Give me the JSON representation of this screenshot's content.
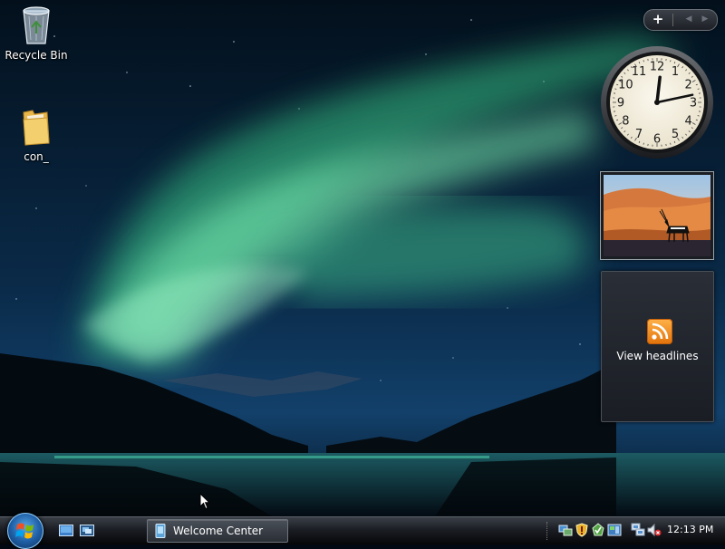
{
  "desktop": {
    "icons": [
      {
        "name": "recycle-bin",
        "label": "Recycle Bin"
      },
      {
        "name": "folder",
        "label": "con_"
      }
    ]
  },
  "sidebar": {
    "controls": {
      "add": "+"
    },
    "clock": {
      "numerals": [
        "12",
        "1",
        "2",
        "3",
        "4",
        "5",
        "6",
        "7",
        "8",
        "9",
        "10",
        "11"
      ],
      "hour": 12,
      "minute": 13
    },
    "feed": {
      "label": "View headlines",
      "icon": "rss-feed-icon",
      "accent": "#f59a23"
    }
  },
  "taskbar": {
    "start_icon": "windows-logo-icon",
    "quick_launch": [
      "show-desktop-icon",
      "switch-windows-icon"
    ],
    "tasks": [
      {
        "label": "Welcome Center"
      }
    ],
    "tray_icons": [
      "network-icon",
      "security-shield-icon",
      "update-icon",
      "device-icon",
      "network-connection-icon",
      "volume-muted-icon"
    ],
    "clock": "12:13 PM"
  },
  "colors": {
    "aurora": "#4de0a0",
    "sky": "#05111f",
    "taskbar": "#1b1e24"
  }
}
